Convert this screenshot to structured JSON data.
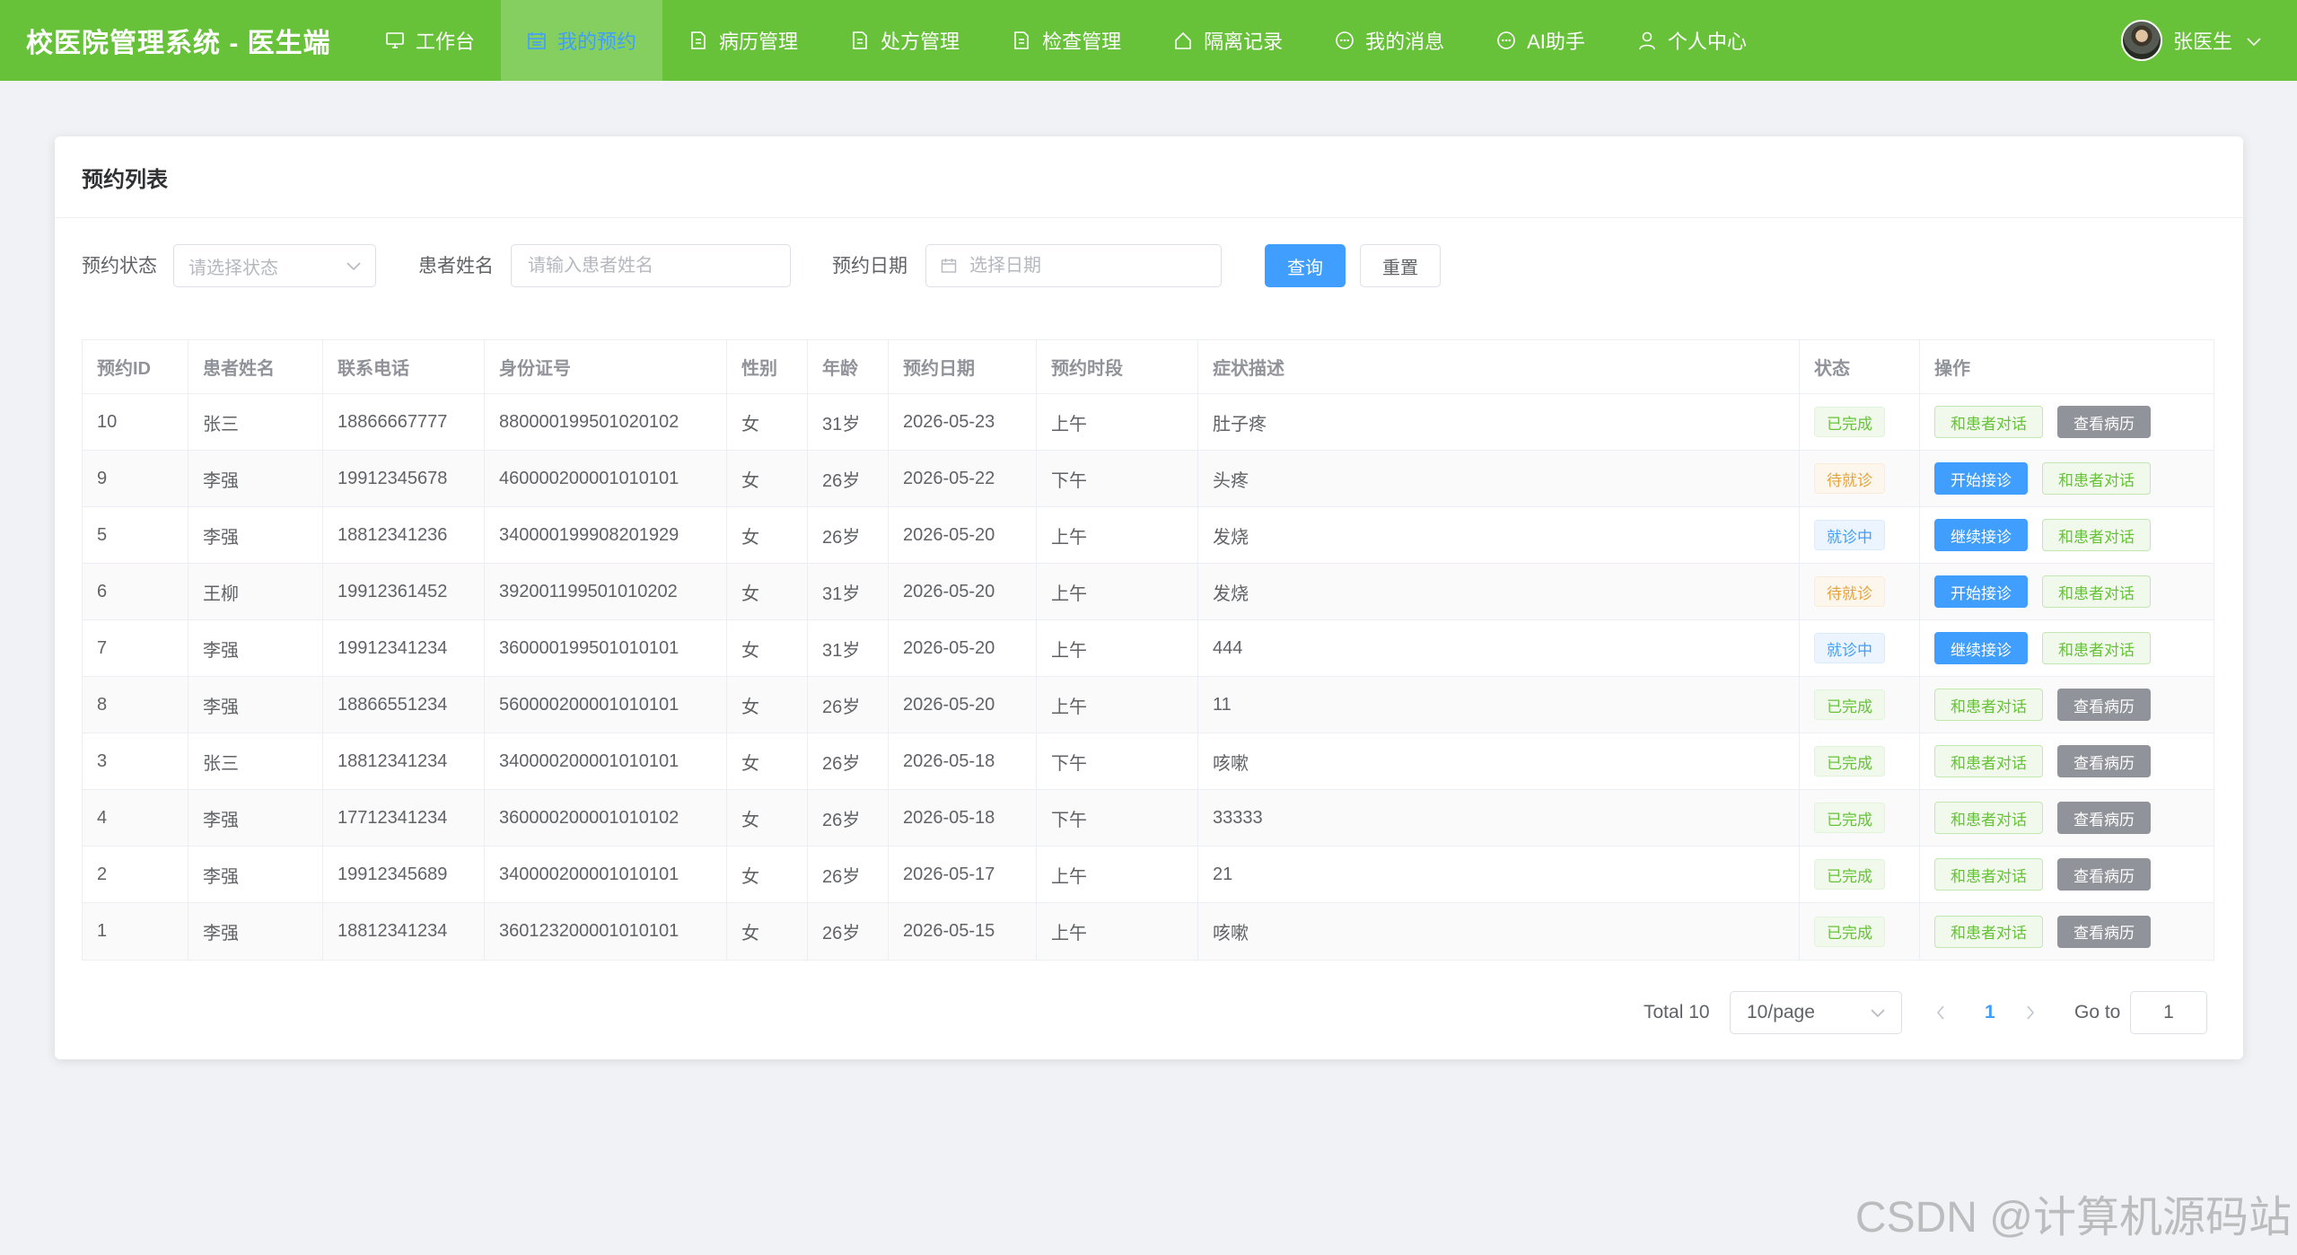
{
  "app": {
    "title": "校医院管理系统 - 医生端"
  },
  "nav": [
    {
      "label": "工作台",
      "icon": "monitor-icon",
      "active": false
    },
    {
      "label": "我的预约",
      "icon": "calendar-icon",
      "active": true
    },
    {
      "label": "病历管理",
      "icon": "document-icon",
      "active": false
    },
    {
      "label": "处方管理",
      "icon": "document-icon",
      "active": false
    },
    {
      "label": "检查管理",
      "icon": "document-icon",
      "active": false
    },
    {
      "label": "隔离记录",
      "icon": "house-icon",
      "active": false
    },
    {
      "label": "我的消息",
      "icon": "chat-icon",
      "active": false
    },
    {
      "label": "AI助手",
      "icon": "chat-icon",
      "active": false
    },
    {
      "label": "个人中心",
      "icon": "user-icon",
      "active": false
    }
  ],
  "user": {
    "name": "张医生"
  },
  "card": {
    "title": "预约列表"
  },
  "filter": {
    "status_label": "预约状态",
    "status_placeholder": "请选择状态",
    "name_label": "患者姓名",
    "name_placeholder": "请输入患者姓名",
    "date_label": "预约日期",
    "date_placeholder": "选择日期",
    "search_label": "查询",
    "reset_label": "重置"
  },
  "table": {
    "columns": [
      "预约ID",
      "患者姓名",
      "联系电话",
      "身份证号",
      "性别",
      "年龄",
      "预约日期",
      "预约时段",
      "症状描述",
      "状态",
      "操作"
    ],
    "rows": [
      {
        "id": "10",
        "name": "张三",
        "phone": "18866667777",
        "idcard": "880000199501020102",
        "gender": "女",
        "age": "31岁",
        "date": "2026-05-23",
        "slot": "上午",
        "symptom": "肚子疼",
        "status": "已完成",
        "status_type": "success",
        "actions": [
          {
            "label": "和患者对话",
            "type": "success-plain"
          },
          {
            "label": "查看病历",
            "type": "gray"
          }
        ]
      },
      {
        "id": "9",
        "name": "李强",
        "phone": "19912345678",
        "idcard": "460000200001010101",
        "gender": "女",
        "age": "26岁",
        "date": "2026-05-22",
        "slot": "下午",
        "symptom": "头疼",
        "status": "待就诊",
        "status_type": "warning",
        "actions": [
          {
            "label": "开始接诊",
            "type": "primary"
          },
          {
            "label": "和患者对话",
            "type": "success-plain"
          }
        ]
      },
      {
        "id": "5",
        "name": "李强",
        "phone": "18812341236",
        "idcard": "340000199908201929",
        "gender": "女",
        "age": "26岁",
        "date": "2026-05-20",
        "slot": "上午",
        "symptom": "发烧",
        "status": "就诊中",
        "status_type": "info",
        "actions": [
          {
            "label": "继续接诊",
            "type": "primary"
          },
          {
            "label": "和患者对话",
            "type": "success-plain"
          }
        ]
      },
      {
        "id": "6",
        "name": "王柳",
        "phone": "19912361452",
        "idcard": "392001199501010202",
        "gender": "女",
        "age": "31岁",
        "date": "2026-05-20",
        "slot": "上午",
        "symptom": "发烧",
        "status": "待就诊",
        "status_type": "warning",
        "actions": [
          {
            "label": "开始接诊",
            "type": "primary"
          },
          {
            "label": "和患者对话",
            "type": "success-plain"
          }
        ]
      },
      {
        "id": "7",
        "name": "李强",
        "phone": "19912341234",
        "idcard": "360000199501010101",
        "gender": "女",
        "age": "31岁",
        "date": "2026-05-20",
        "slot": "上午",
        "symptom": "444",
        "status": "就诊中",
        "status_type": "info",
        "actions": [
          {
            "label": "继续接诊",
            "type": "primary"
          },
          {
            "label": "和患者对话",
            "type": "success-plain"
          }
        ]
      },
      {
        "id": "8",
        "name": "李强",
        "phone": "18866551234",
        "idcard": "560000200001010101",
        "gender": "女",
        "age": "26岁",
        "date": "2026-05-20",
        "slot": "上午",
        "symptom": "11",
        "status": "已完成",
        "status_type": "success",
        "actions": [
          {
            "label": "和患者对话",
            "type": "success-plain"
          },
          {
            "label": "查看病历",
            "type": "gray"
          }
        ]
      },
      {
        "id": "3",
        "name": "张三",
        "phone": "18812341234",
        "idcard": "340000200001010101",
        "gender": "女",
        "age": "26岁",
        "date": "2026-05-18",
        "slot": "下午",
        "symptom": "咳嗽",
        "status": "已完成",
        "status_type": "success",
        "actions": [
          {
            "label": "和患者对话",
            "type": "success-plain"
          },
          {
            "label": "查看病历",
            "type": "gray"
          }
        ]
      },
      {
        "id": "4",
        "name": "李强",
        "phone": "17712341234",
        "idcard": "360000200001010102",
        "gender": "女",
        "age": "26岁",
        "date": "2026-05-18",
        "slot": "下午",
        "symptom": "33333",
        "status": "已完成",
        "status_type": "success",
        "actions": [
          {
            "label": "和患者对话",
            "type": "success-plain"
          },
          {
            "label": "查看病历",
            "type": "gray"
          }
        ]
      },
      {
        "id": "2",
        "name": "李强",
        "phone": "19912345689",
        "idcard": "340000200001010101",
        "gender": "女",
        "age": "26岁",
        "date": "2026-05-17",
        "slot": "上午",
        "symptom": "21",
        "status": "已完成",
        "status_type": "success",
        "actions": [
          {
            "label": "和患者对话",
            "type": "success-plain"
          },
          {
            "label": "查看病历",
            "type": "gray"
          }
        ]
      },
      {
        "id": "1",
        "name": "李强",
        "phone": "18812341234",
        "idcard": "360123200001010101",
        "gender": "女",
        "age": "26岁",
        "date": "2026-05-15",
        "slot": "上午",
        "symptom": "咳嗽",
        "status": "已完成",
        "status_type": "success",
        "actions": [
          {
            "label": "和患者对话",
            "type": "success-plain"
          },
          {
            "label": "查看病历",
            "type": "gray"
          }
        ]
      }
    ]
  },
  "pagination": {
    "total_text": "Total 10",
    "page_size": "10/page",
    "current_page": "1",
    "goto_label": "Go to",
    "goto_value": "1"
  },
  "watermark": "CSDN @计算机源码站"
}
